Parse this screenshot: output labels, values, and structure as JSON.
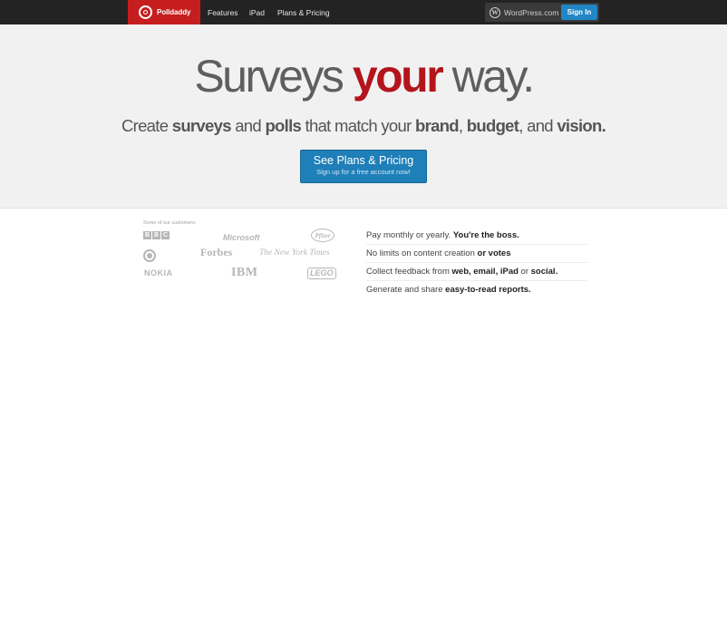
{
  "nav": {
    "brand": "Polldaddy",
    "items": [
      "Features",
      "iPad",
      "Plans & Pricing"
    ],
    "wordpress_label": "WordPress.com",
    "signin_label": "Sign In"
  },
  "hero": {
    "headline_pre": "Surveys ",
    "headline_accent": "your",
    "headline_post": " way.",
    "subhead_parts": [
      "Create ",
      "surveys",
      " and ",
      "polls",
      " that match your ",
      "brand",
      ", ",
      "budget",
      ", and ",
      "vision."
    ],
    "cta_title": "See Plans & Pricing",
    "cta_subtitle": "Sign up for a free account now!"
  },
  "customers": {
    "label": "Some of our customers:",
    "logos": [
      "BBC",
      "Microsoft",
      "Pfizer",
      "CBS",
      "Forbes",
      "The New York Times",
      "NOKIA",
      "IBM",
      "LEGO"
    ]
  },
  "features": [
    {
      "text": "Pay monthly or yearly. ",
      "bold": "You're the boss."
    },
    {
      "text": "No limits on content creation ",
      "bold": "or votes"
    },
    {
      "text": "Collect feedback from ",
      "bold": "web, email, iPad",
      "text2": " or ",
      "bold2": "social."
    },
    {
      "text": "Generate and share ",
      "bold": "easy-to-read reports."
    }
  ],
  "colors": {
    "brand_red": "#c61e1e",
    "accent_red": "#b4141b",
    "cta_blue": "#1f7fb8",
    "signin_blue": "#2186c4"
  }
}
